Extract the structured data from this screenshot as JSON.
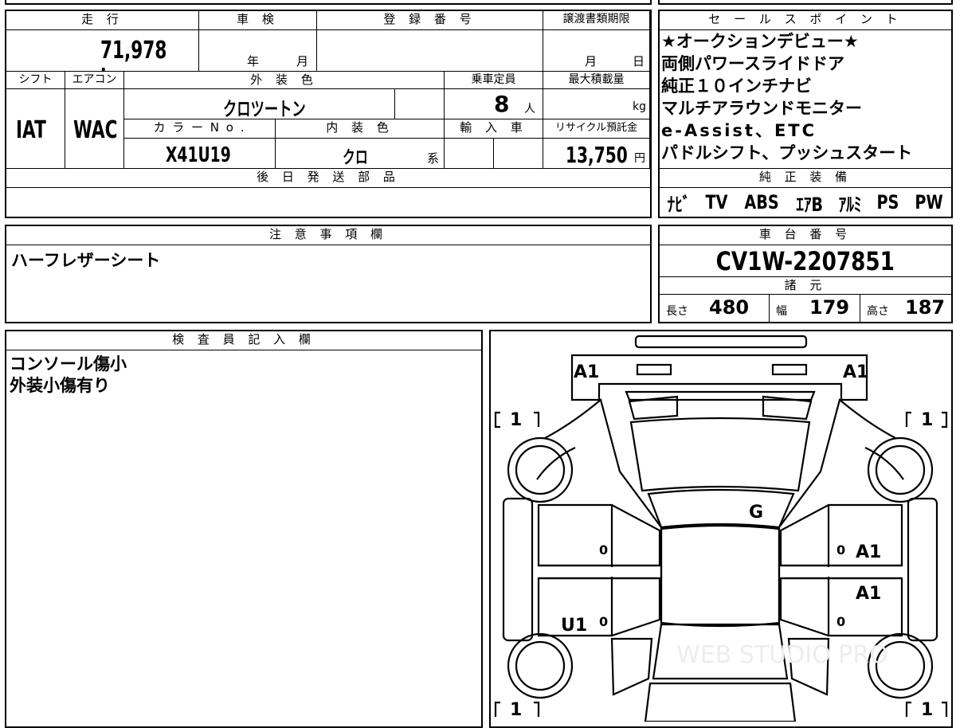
{
  "top": {
    "mileage_label": "走 行",
    "mileage": "71,978 km",
    "inspection_label": "車 検",
    "year_unit": "年",
    "month_unit": "月",
    "reg_label": "登 録 番 号",
    "transfer_label": "譲渡書類期限",
    "month2": "月",
    "day2": "日",
    "shift_label": "シフト",
    "ac_label": "エアコン",
    "exterior_label": "外 装 色",
    "capacity_label": "乗車定員",
    "maxload_label": "最大積載量",
    "shift": "IAT",
    "ac": "WAC",
    "exterior": "クロツートン",
    "capacity": "8",
    "capacity_unit": "人",
    "load_unit": "kg",
    "color_no_label": "カ ラ ー N o .",
    "interior_label": "内 装 色",
    "import_label": "輸 入 車",
    "recycle_label": "リサイクル預託金",
    "color_no": "X41U19",
    "interior": "クロ",
    "interior_unit": "系",
    "recycle": "13,750",
    "yen": "円",
    "later_label": "後 日 発 送 部 品"
  },
  "sales": {
    "label": "セ ー ル ス ポ イ ン ト",
    "lines": [
      "★オークションデビュー★",
      "両側パワースライドドア",
      "純正１０インチナビ",
      "マルチアラウンドモニター",
      "e-Assist、ETC",
      "パドルシフト、プッシュスタート"
    ],
    "equip_label": "純 正 装 備",
    "equip": [
      "ﾅﾋﾞ",
      "TV",
      "ABS",
      "ｴｱB",
      "ｱﾙﾐ",
      "PS",
      "PW"
    ]
  },
  "notes": {
    "label": "注 意 事 項 欄",
    "text": "ハーフレザーシート"
  },
  "chassis": {
    "label": "車 台 番 号",
    "value": "CV1W-2207851",
    "spec_label": "諸 元",
    "len_label": "長さ",
    "len": "480",
    "wid_label": "幅",
    "wid": "179",
    "hgt_label": "高さ",
    "hgt": "187"
  },
  "inspector": {
    "label": "検 査 員 記 入 欄",
    "lines": [
      "コンソール傷小",
      "外装小傷有り"
    ]
  },
  "diagram": {
    "marks": {
      "a1_tl": "A1",
      "a1_tr": "A1",
      "g": "G",
      "a1_r1": "A1",
      "a1_r2": "A1",
      "u1": "U1",
      "zero": "0",
      "bl": "[",
      "br": "]",
      "one": "1"
    },
    "watermark": "WEB STUDIO PRO"
  }
}
